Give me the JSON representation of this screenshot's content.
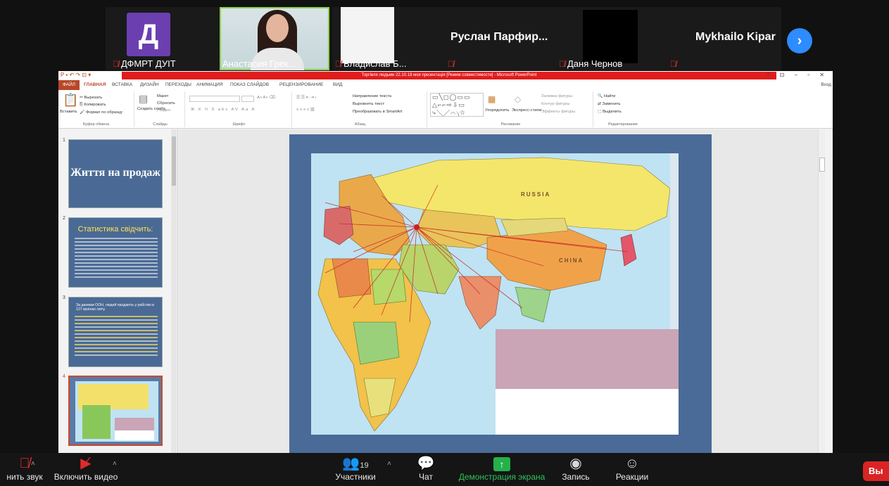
{
  "participants": [
    {
      "name": "ДФМРТ ДУІТ",
      "initial": "Д"
    },
    {
      "name": "Анастасия Грек..."
    },
    {
      "name": "Владислав Б..."
    },
    {
      "name": "Руслан  Парфир..."
    },
    {
      "name": "Даня Чернов"
    },
    {
      "name": "Mykhailo Kipar"
    }
  ],
  "ppt": {
    "window_title": "Торгівля людьми 22.10.18 моя презентація [Режим совместимости] - Microsoft PowerPoint",
    "win_controls": "? ⊡ – ▫ ✕",
    "tabs": [
      "ФАЙЛ",
      "ГЛАВНАЯ",
      "ВСТАВКА",
      "ДИЗАЙН",
      "ПЕРЕХОДЫ",
      "АНИМАЦИЯ",
      "ПОКАЗ СЛАЙДОВ",
      "РЕЦЕНЗИРОВАНИЕ",
      "ВИД"
    ],
    "signin": "Вход",
    "ribbon": {
      "cut": "Вырезать",
      "copy": "Копировать",
      "format_painter": "Формат по образцу",
      "paste": "Вставить",
      "clipboard_group": "Буфер обмена",
      "layout": "Макет",
      "reset": "Сбросить",
      "section": "Раздел",
      "new_slide": "Создать слайд",
      "slides_group": "Слайды",
      "font_group": "Шрифт",
      "text_direction": "Направление текста",
      "align_text": "Выровнять текст",
      "smartart": "Преобразовать в SmartArt",
      "paragraph_group": "Абзац",
      "arrange": "Упорядочить",
      "quick_styles": "Экспресс-стили",
      "shape_fill": "Заливка фигуры",
      "shape_outline": "Контур фигуры",
      "shape_effects": "Эффекты фигуры",
      "drawing_group": "Рисование",
      "find": "Найти",
      "replace": "Заменить",
      "select": "Выделить",
      "editing_group": "Редактирование"
    },
    "slides": [
      {
        "num": "1",
        "title": "Життя на продаж"
      },
      {
        "num": "2",
        "title": "Статистика свідчить:"
      },
      {
        "num": "3",
        "text": "За даними ООН, людей продають у рабство в 127 країнах світу."
      },
      {
        "num": "4"
      }
    ],
    "map_labels": {
      "russia": "RUSSIA",
      "china": "CHINA"
    }
  },
  "toolbar": {
    "unmute": "нить звук",
    "start_video": "Включить видео",
    "participants": "Участники",
    "participants_count": "19",
    "chat": "Чат",
    "share": "Демонстрация экрана",
    "record": "Запись",
    "reactions": "Реакции",
    "end": "Вы"
  }
}
